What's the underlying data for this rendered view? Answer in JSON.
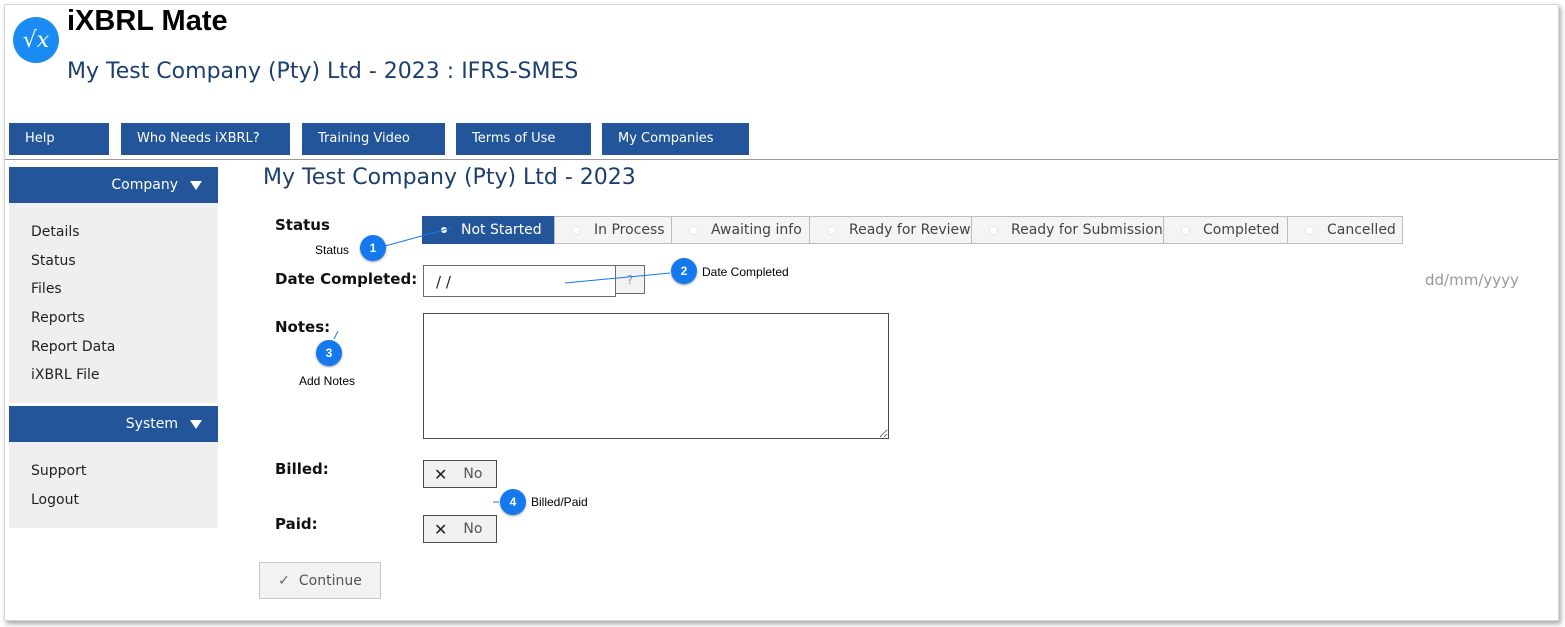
{
  "app": {
    "title": "iXBRL Mate",
    "company_header": "My Test Company (Pty) Ltd - 2023 : IFRS-SMES",
    "logo_glyph": "√x"
  },
  "nav": {
    "items": [
      "Help",
      "Who Needs iXBRL?",
      "Training Video",
      "Terms of Use",
      "My Companies"
    ]
  },
  "sidebar": {
    "company": {
      "title": "Company",
      "items": [
        "Details",
        "Status",
        "Files",
        "Reports",
        "Report Data",
        "iXBRL File"
      ]
    },
    "system": {
      "title": "System",
      "items": [
        "Support",
        "Logout"
      ]
    }
  },
  "page": {
    "title": "My Test Company (Pty) Ltd - 2023"
  },
  "form": {
    "status_label": "Status",
    "status_options": [
      "Not Started",
      "In Process",
      "Awaiting info",
      "Ready for Review",
      "Ready for Submission",
      "Completed",
      "Cancelled"
    ],
    "status_selected": "Not Started",
    "date_label": "Date Completed:",
    "date_value": "/ /",
    "date_help": "?",
    "date_format": "dd/mm/yyyy",
    "notes_label": "Notes:",
    "notes_value": "",
    "billed_label": "Billed:",
    "billed_value": "No",
    "paid_label": "Paid:",
    "paid_value": "No",
    "continue_label": "Continue"
  },
  "callouts": [
    {
      "number": "1",
      "text": "Status"
    },
    {
      "number": "2",
      "text": "Date Completed"
    },
    {
      "number": "3",
      "text": "Add Notes"
    },
    {
      "number": "4",
      "text": "Billed/Paid"
    }
  ],
  "colors": {
    "nav_bg": "#23559a",
    "title_text": "#1d3f6e",
    "callout": "#1478ef",
    "sidebar_panel": "#efefef"
  }
}
